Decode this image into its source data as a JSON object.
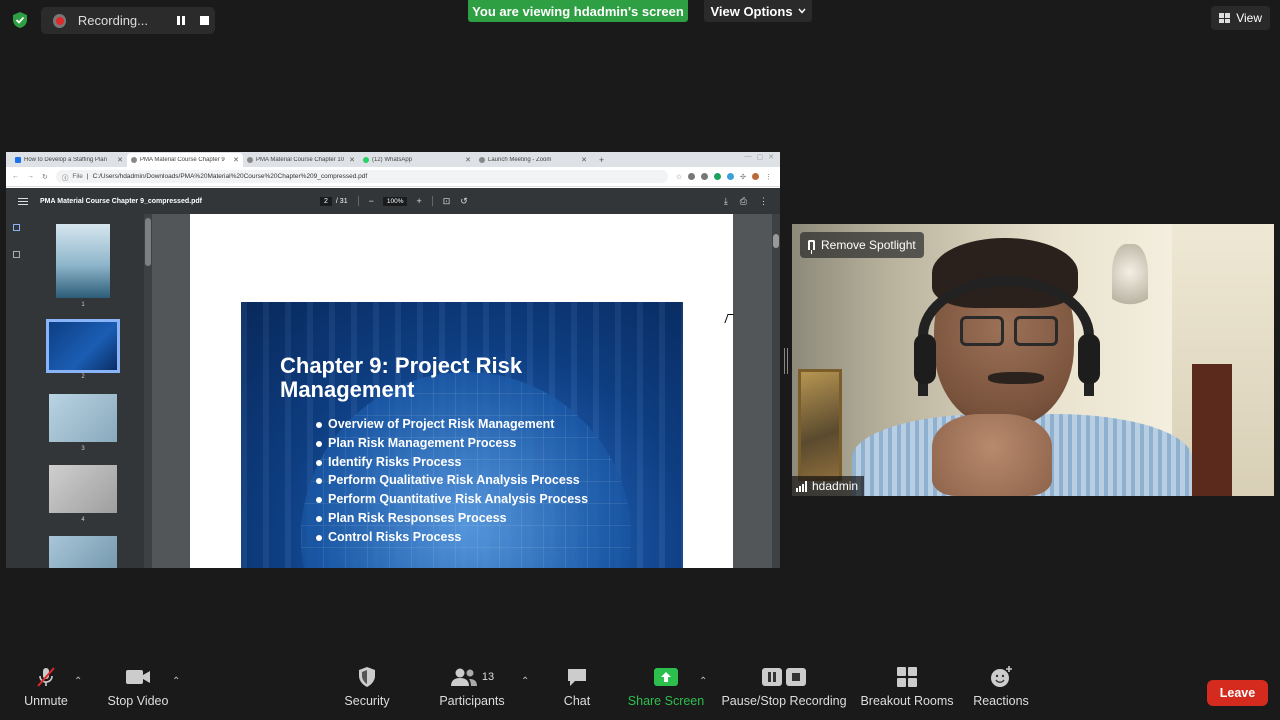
{
  "top_bar": {
    "recording_label": "Recording...",
    "viewing_banner": "You are viewing hdadmin's screen",
    "view_options_label": "View Options",
    "view_label": "View"
  },
  "shared_screen": {
    "browser": {
      "tabs": [
        {
          "title": "How to Develop a Staffing Plan",
          "icon": "sheets-icon"
        },
        {
          "title": "PMA Material Course Chapter 9",
          "icon": "globe-icon",
          "active": true
        },
        {
          "title": "PMA Material Course Chapter 10",
          "icon": "globe-icon"
        },
        {
          "title": "(12) WhatsApp",
          "icon": "whatsapp-icon"
        },
        {
          "title": "Launch Meeting - Zoom",
          "icon": "globe-icon"
        }
      ],
      "address_scheme": "File",
      "address": "C:/Users/hdadmin/Downloads/PMA%20Material%20Course%20Chapter%209_compressed.pdf"
    },
    "pdf": {
      "filename": "PMA Material Course Chapter 9_compressed.pdf",
      "current_page": "2",
      "total_pages": "/ 31",
      "zoom": "100%",
      "thumbnails": [
        "1",
        "2",
        "3",
        "4"
      ],
      "selected_thumbnail": "2",
      "slide_title": "Chapter 9: Project Risk Management",
      "slide_items": [
        "Overview of Project Risk Management",
        "Plan Risk Management Process",
        "Identify Risks Process",
        "Perform Qualitative Risk Analysis Process",
        "Perform Quantitative Risk Analysis Process",
        "Plan Risk Responses Process",
        "Control Risks Process"
      ]
    }
  },
  "video": {
    "spotlight_label": "Remove Spotlight",
    "participant_name": "hdadmin"
  },
  "controls": {
    "unmute": "Unmute",
    "stop_video": "Stop Video",
    "security": "Security",
    "participants": "Participants",
    "participants_count": "13",
    "chat": "Chat",
    "share_screen": "Share Screen",
    "pause_stop_recording": "Pause/Stop Recording",
    "breakout_rooms": "Breakout Rooms",
    "reactions": "Reactions",
    "leave": "Leave"
  },
  "colors": {
    "banner_green": "#2ea043",
    "leave_red": "#d52b1e",
    "share_green": "#2dbf4e"
  }
}
